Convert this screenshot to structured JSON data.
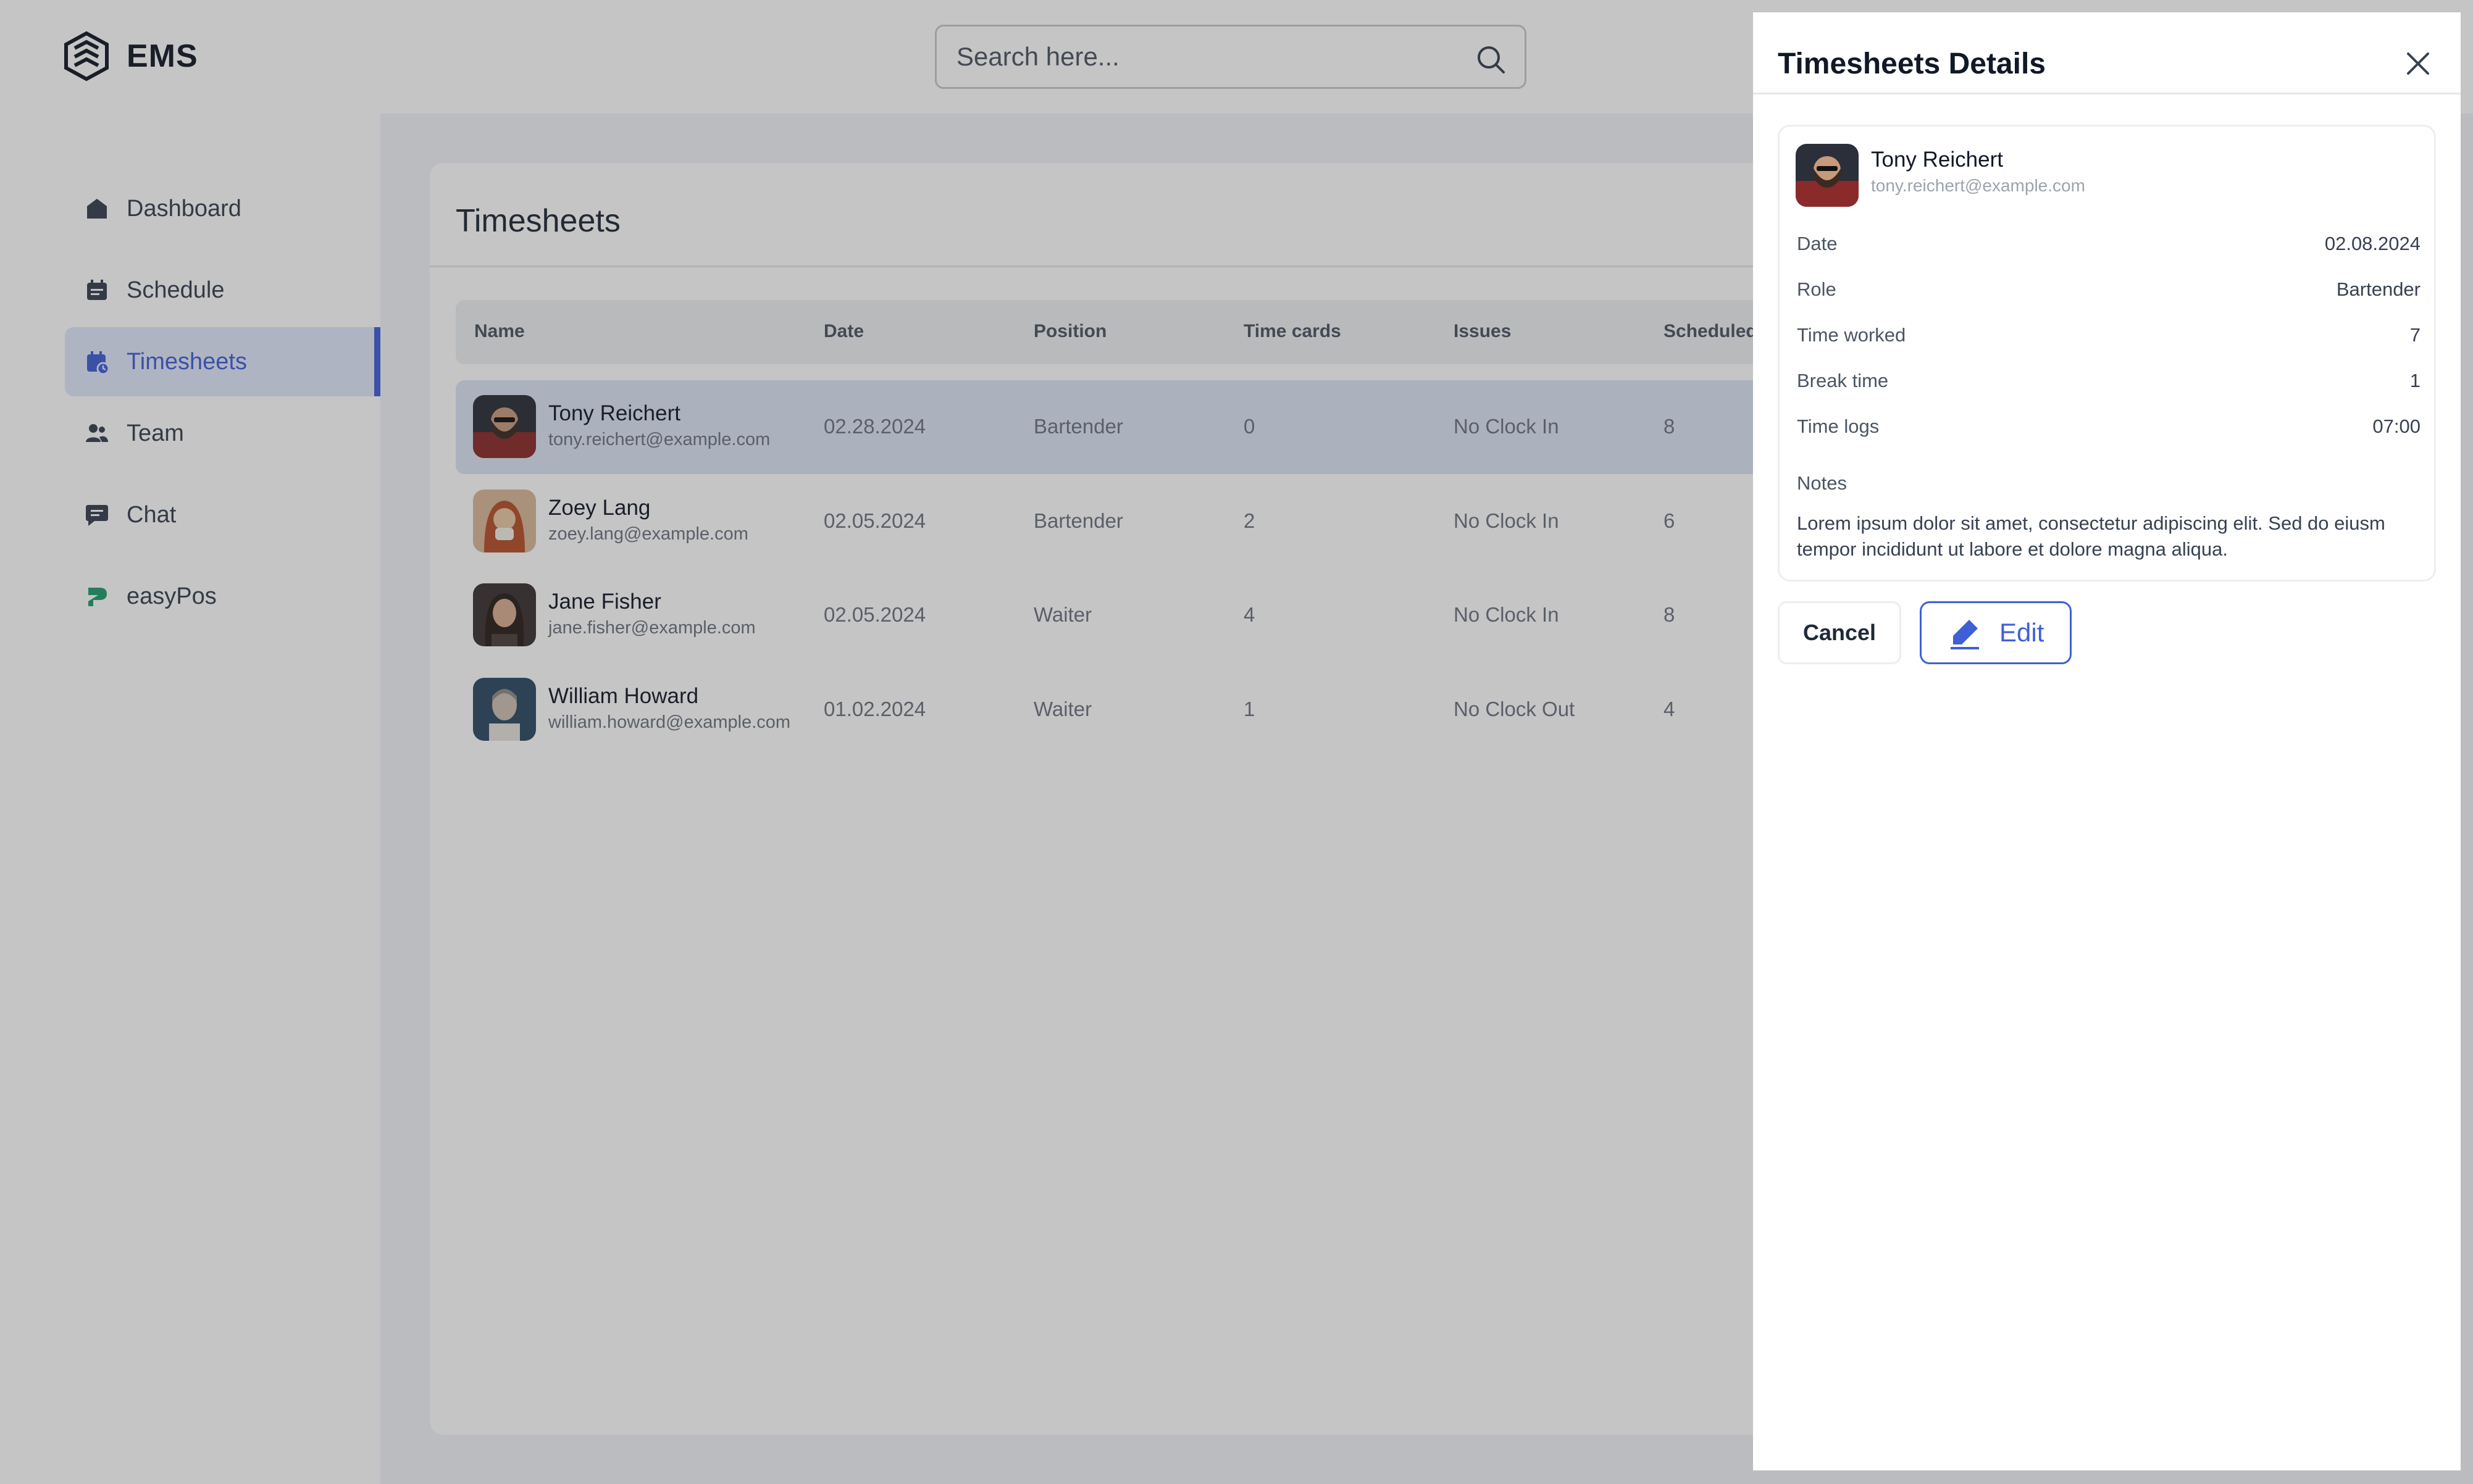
{
  "app": {
    "name": "EMS"
  },
  "search": {
    "placeholder": "Search here..."
  },
  "sidebar": {
    "items": [
      {
        "label": "Dashboard",
        "icon": "home-icon"
      },
      {
        "label": "Schedule",
        "icon": "calendar-icon"
      },
      {
        "label": "Timesheets",
        "icon": "timesheet-icon",
        "active": true
      },
      {
        "label": "Team",
        "icon": "team-icon"
      },
      {
        "label": "Chat",
        "icon": "chat-icon"
      },
      {
        "label": "easyPos",
        "icon": "easypos-logo-icon"
      }
    ]
  },
  "main": {
    "title": "Timesheets",
    "columns": [
      "Name",
      "Date",
      "Position",
      "Time cards",
      "Issues",
      "Scheduled"
    ],
    "rows": [
      {
        "name": "Tony Reichert",
        "email": "tony.reichert@example.com",
        "date": "02.28.2024",
        "position": "Bartender",
        "time_cards": "0",
        "issues": "No Clock In",
        "scheduled": "8",
        "selected": true
      },
      {
        "name": "Zoey Lang",
        "email": "zoey.lang@example.com",
        "date": "02.05.2024",
        "position": "Bartender",
        "time_cards": "2",
        "issues": "No Clock In",
        "scheduled": "6"
      },
      {
        "name": "Jane Fisher",
        "email": "jane.fisher@example.com",
        "date": "02.05.2024",
        "position": "Waiter",
        "time_cards": "4",
        "issues": "No Clock In",
        "scheduled": "8"
      },
      {
        "name": "William Howard",
        "email": "william.howard@example.com",
        "date": "01.02.2024",
        "position": "Waiter",
        "time_cards": "1",
        "issues": "No Clock Out",
        "scheduled": "4"
      }
    ]
  },
  "drawer": {
    "title": "Timesheets Details",
    "employee": {
      "name": "Tony Reichert",
      "email": "tony.reichert@example.com"
    },
    "fields": [
      {
        "label": "Date",
        "value": "02.08.2024"
      },
      {
        "label": "Role",
        "value": "Bartender"
      },
      {
        "label": "Time worked",
        "value": "7"
      },
      {
        "label": "Break time",
        "value": "1"
      },
      {
        "label": "Time logs",
        "value": "07:00"
      }
    ],
    "notes_label": "Notes",
    "notes": "Lorem ipsum dolor sit amet, consectetur adipiscing elit. Sed do eiusm tempor incididunt ut labore et dolore magna aliqua.",
    "cancel_label": "Cancel",
    "edit_label": "Edit"
  },
  "colors": {
    "accent": "#3f5fd6",
    "selected_row": "#dce5f5",
    "active_nav": "#e1e8fb",
    "overlay": "rgba(45,45,45,0.28)"
  }
}
